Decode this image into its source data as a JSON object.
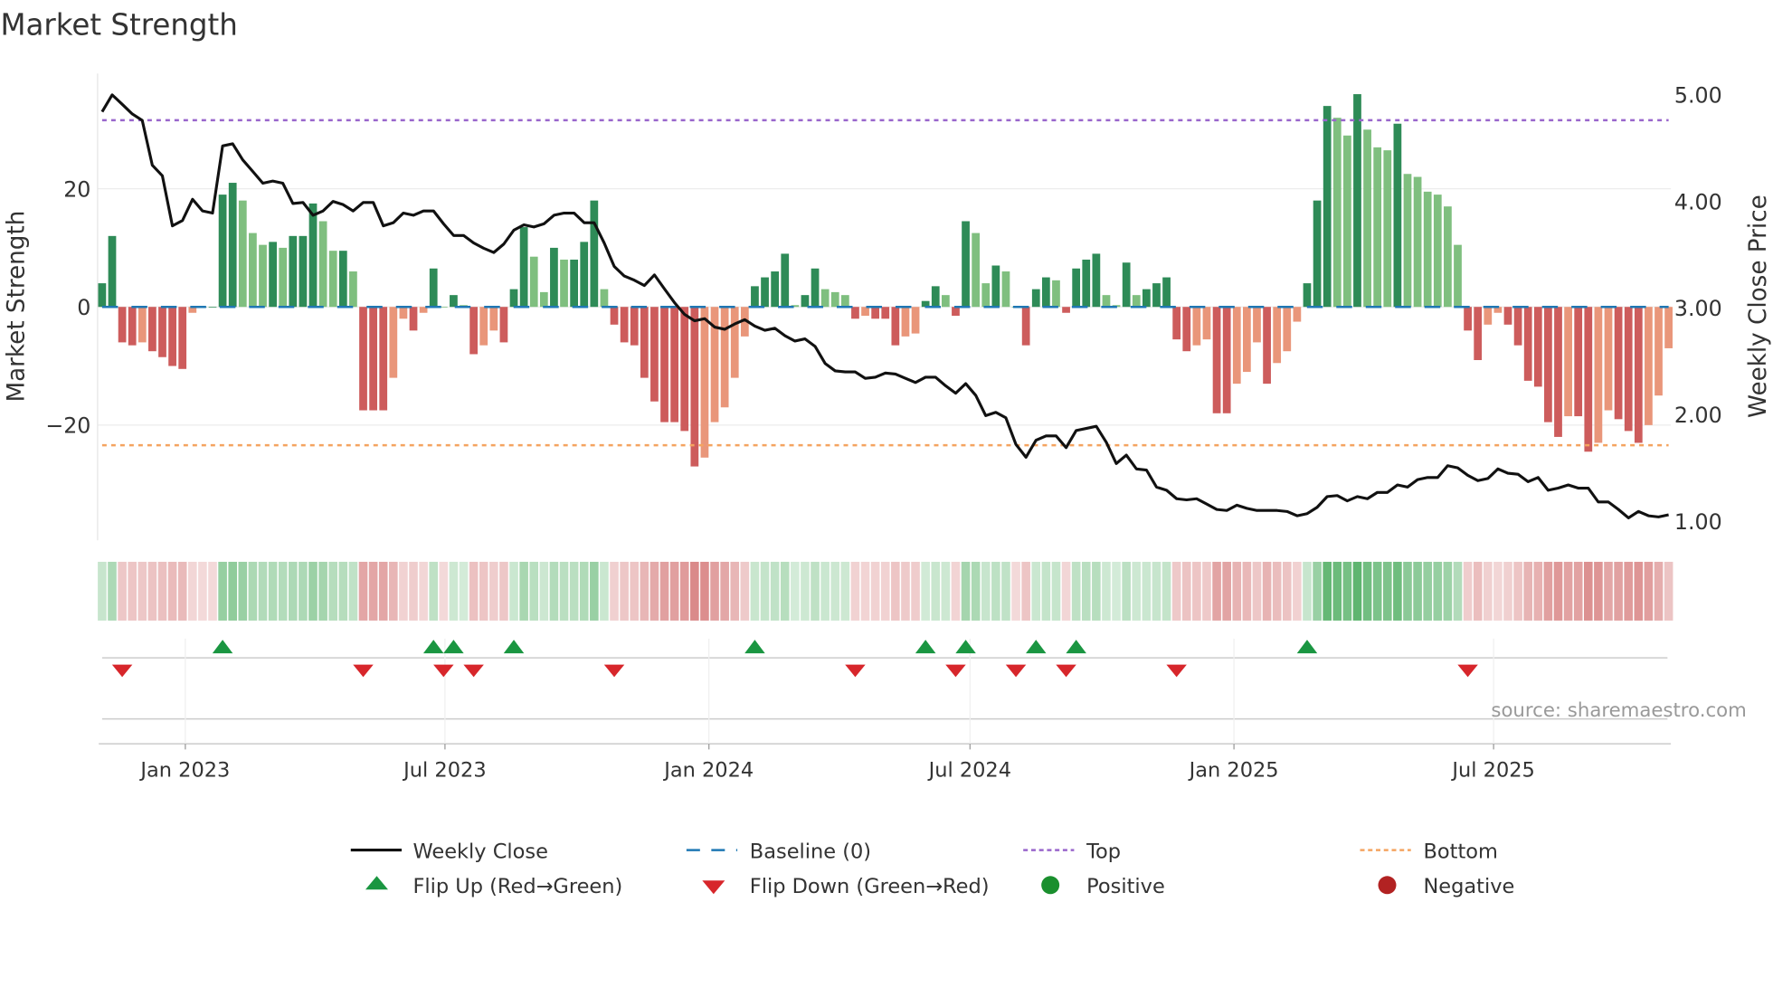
{
  "chart_data": {
    "type": "bar",
    "title": "Market Strength",
    "ylabel": "Market Strength",
    "y2label": "Weekly Close Price",
    "ylim": [
      -39.5,
      39.5
    ],
    "y2lim": [
      0.82,
      5.2
    ],
    "yticks": [
      {
        "v": 20,
        "label": "20"
      },
      {
        "v": 0,
        "label": "0"
      },
      {
        "v": -20,
        "label": "−20"
      }
    ],
    "y2ticks": [
      {
        "v": 5,
        "label": "5.00"
      },
      {
        "v": 4,
        "label": "4.00"
      },
      {
        "v": 3,
        "label": "3.00"
      },
      {
        "v": 2,
        "label": "2.00"
      },
      {
        "v": 1,
        "label": "1.00"
      }
    ],
    "xticks": [
      {
        "date": "2023-01-01",
        "label": "Jan 2023"
      },
      {
        "date": "2023-07-01",
        "label": "Jul 2023"
      },
      {
        "date": "2024-01-01",
        "label": "Jan 2024"
      },
      {
        "date": "2024-07-01",
        "label": "Jul 2024"
      },
      {
        "date": "2025-01-01",
        "label": "Jan 2025"
      },
      {
        "date": "2025-07-01",
        "label": "Jul 2025"
      }
    ],
    "top_level": 31.6,
    "bottom_level": -23.4,
    "baseline": 0,
    "grid": true,
    "legend_position": "bottom",
    "colors": {
      "pos_strong": "#2e8b57",
      "pos_weak": "#7fbf7f",
      "neg_strong": "#cd5c5c",
      "neg_weak": "#e9967a",
      "close": "#111111",
      "baseline": "#1f77b4",
      "top": "#9966cc",
      "bottom": "#f4a460",
      "flip_up": "#1a9641",
      "flip_down": "#d7262b",
      "positive": "#1a8f2e",
      "negative": "#b22222"
    },
    "dates": [
      "2022-11-04",
      "2022-11-11",
      "2022-11-18",
      "2022-11-25",
      "2022-12-02",
      "2022-12-09",
      "2022-12-16",
      "2022-12-23",
      "2022-12-30",
      "2023-01-06",
      "2023-01-13",
      "2023-01-20",
      "2023-01-27",
      "2023-02-03",
      "2023-02-10",
      "2023-02-17",
      "2023-02-24",
      "2023-03-03",
      "2023-03-10",
      "2023-03-17",
      "2023-03-24",
      "2023-03-31",
      "2023-04-07",
      "2023-04-14",
      "2023-04-21",
      "2023-04-28",
      "2023-05-05",
      "2023-05-12",
      "2023-05-19",
      "2023-05-26",
      "2023-06-02",
      "2023-06-09",
      "2023-06-16",
      "2023-06-23",
      "2023-06-30",
      "2023-07-07",
      "2023-07-14",
      "2023-07-21",
      "2023-07-28",
      "2023-08-04",
      "2023-08-11",
      "2023-08-18",
      "2023-08-25",
      "2023-09-01",
      "2023-09-08",
      "2023-09-15",
      "2023-09-22",
      "2023-09-29",
      "2023-10-06",
      "2023-10-13",
      "2023-10-20",
      "2023-10-27",
      "2023-11-03",
      "2023-11-10",
      "2023-11-17",
      "2023-11-24",
      "2023-12-01",
      "2023-12-08",
      "2023-12-15",
      "2023-12-22",
      "2023-12-29",
      "2024-01-05",
      "2024-01-12",
      "2024-01-19",
      "2024-01-26",
      "2024-02-02",
      "2024-02-09",
      "2024-02-16",
      "2024-02-23",
      "2024-03-01",
      "2024-03-08",
      "2024-03-15",
      "2024-03-22",
      "2024-03-29",
      "2024-04-05",
      "2024-04-12",
      "2024-04-19",
      "2024-04-26",
      "2024-05-03",
      "2024-05-10",
      "2024-05-17",
      "2024-05-24",
      "2024-05-31",
      "2024-06-07",
      "2024-06-14",
      "2024-06-21",
      "2024-06-28",
      "2024-07-05",
      "2024-07-12",
      "2024-07-19",
      "2024-07-26",
      "2024-08-02",
      "2024-08-09",
      "2024-08-16",
      "2024-08-23",
      "2024-08-30",
      "2024-09-06",
      "2024-09-13",
      "2024-09-20",
      "2024-09-27",
      "2024-10-04",
      "2024-10-11",
      "2024-10-18",
      "2024-10-25",
      "2024-11-01",
      "2024-11-08",
      "2024-11-15",
      "2024-11-22",
      "2024-11-29",
      "2024-12-06",
      "2024-12-13",
      "2024-12-20",
      "2024-12-27",
      "2025-01-03",
      "2025-01-10",
      "2025-01-17",
      "2025-01-24",
      "2025-01-31",
      "2025-02-07",
      "2025-02-14",
      "2025-02-21",
      "2025-02-28",
      "2025-03-07",
      "2025-03-14",
      "2025-03-21",
      "2025-03-28",
      "2025-04-04",
      "2025-04-11",
      "2025-04-18",
      "2025-04-25",
      "2025-05-02",
      "2025-05-09",
      "2025-05-16",
      "2025-05-23",
      "2025-05-30",
      "2025-06-06",
      "2025-06-13",
      "2025-06-20",
      "2025-06-27",
      "2025-07-04",
      "2025-07-11",
      "2025-07-18",
      "2025-07-25",
      "2025-08-01",
      "2025-08-08",
      "2025-08-15",
      "2025-08-22",
      "2025-08-29",
      "2025-09-05",
      "2025-09-12",
      "2025-09-19",
      "2025-09-26",
      "2025-10-03",
      "2025-10-10",
      "2025-10-17",
      "2025-10-24",
      "2025-10-31"
    ],
    "strength": [
      4,
      12,
      -6,
      -6.5,
      -6,
      -7.5,
      -8.5,
      -10,
      -10.5,
      -1,
      0,
      0,
      19,
      21,
      18,
      12.5,
      10.5,
      11,
      10,
      12,
      12,
      17.5,
      14.5,
      9.5,
      9.5,
      6,
      -17.5,
      -17.5,
      -17.5,
      -12,
      -2,
      -4,
      -1,
      6.5,
      0,
      2,
      0.3,
      -8,
      -6.5,
      -4,
      -6,
      3,
      13.5,
      8.5,
      2.5,
      10,
      8,
      8,
      11,
      18,
      3,
      -3,
      -6,
      -6.5,
      -12,
      -16,
      -19.5,
      -19.5,
      -21,
      -27,
      -25.5,
      -19.5,
      -17,
      -12,
      -5,
      3.5,
      5,
      6,
      9,
      0.3,
      2,
      6.5,
      3,
      2.5,
      2,
      -2,
      -1.5,
      -2,
      -2,
      -6.5,
      -5,
      -4.5,
      1,
      3.5,
      2,
      -1.5,
      14.5,
      12.5,
      4,
      7,
      6,
      0,
      -6.5,
      3,
      5,
      4.5,
      -1,
      6.5,
      8,
      9,
      2,
      0.3,
      7.5,
      2,
      3,
      4,
      5,
      -5.5,
      -7.5,
      -6.5,
      -5.5,
      -18,
      -18,
      -13,
      -11,
      -6,
      -13,
      -9.5,
      -7.5,
      -2.5,
      4,
      18,
      34,
      32,
      29,
      36,
      30,
      27,
      26.5,
      31,
      22.5,
      22,
      19.5,
      19,
      17,
      10.5,
      -4,
      -9,
      -3,
      -1,
      -3,
      -6.5,
      -12.5,
      -13.5,
      -19.5,
      -22,
      -18.5,
      -18.5,
      -24.5,
      -23,
      -17.5,
      -19,
      -21,
      -23,
      -20,
      -15,
      -7
    ],
    "close": [
      4.84,
      5.0,
      4.91,
      4.82,
      4.76,
      4.34,
      4.24,
      3.77,
      3.82,
      4.02,
      3.91,
      3.89,
      4.52,
      4.54,
      4.39,
      4.28,
      4.17,
      4.19,
      4.17,
      3.98,
      3.99,
      3.87,
      3.91,
      4.0,
      3.97,
      3.91,
      3.99,
      3.99,
      3.77,
      3.8,
      3.89,
      3.87,
      3.91,
      3.91,
      3.79,
      3.68,
      3.68,
      3.61,
      3.56,
      3.52,
      3.6,
      3.73,
      3.78,
      3.76,
      3.79,
      3.87,
      3.89,
      3.89,
      3.8,
      3.8,
      3.61,
      3.39,
      3.3,
      3.26,
      3.21,
      3.31,
      3.18,
      3.05,
      2.94,
      2.88,
      2.9,
      2.82,
      2.8,
      2.85,
      2.89,
      2.83,
      2.79,
      2.81,
      2.74,
      2.69,
      2.71,
      2.64,
      2.48,
      2.41,
      2.4,
      2.4,
      2.34,
      2.35,
      2.39,
      2.38,
      2.34,
      2.3,
      2.35,
      2.35,
      2.27,
      2.2,
      2.29,
      2.18,
      1.99,
      2.02,
      1.97,
      1.72,
      1.6,
      1.76,
      1.8,
      1.8,
      1.69,
      1.85,
      1.87,
      1.89,
      1.74,
      1.54,
      1.62,
      1.49,
      1.48,
      1.32,
      1.29,
      1.21,
      1.2,
      1.21,
      1.16,
      1.11,
      1.1,
      1.15,
      1.12,
      1.1,
      1.1,
      1.1,
      1.09,
      1.05,
      1.07,
      1.13,
      1.23,
      1.24,
      1.19,
      1.23,
      1.21,
      1.27,
      1.27,
      1.34,
      1.32,
      1.39,
      1.41,
      1.41,
      1.52,
      1.5,
      1.43,
      1.38,
      1.4,
      1.49,
      1.45,
      1.44,
      1.37,
      1.41,
      1.29,
      1.31,
      1.34,
      1.31,
      1.31,
      1.18,
      1.18,
      1.11,
      1.03,
      1.09,
      1.05,
      1.04,
      1.06
    ],
    "legend": {
      "close": "Weekly Close",
      "baseline": "Baseline (0)",
      "top": "Top",
      "bottom": "Bottom",
      "flip_up": "Flip Up (Red→Green)",
      "flip_down": "Flip Down (Green→Red)",
      "positive": "Positive",
      "negative": "Negative"
    },
    "source": "source: sharemaestro.com"
  }
}
